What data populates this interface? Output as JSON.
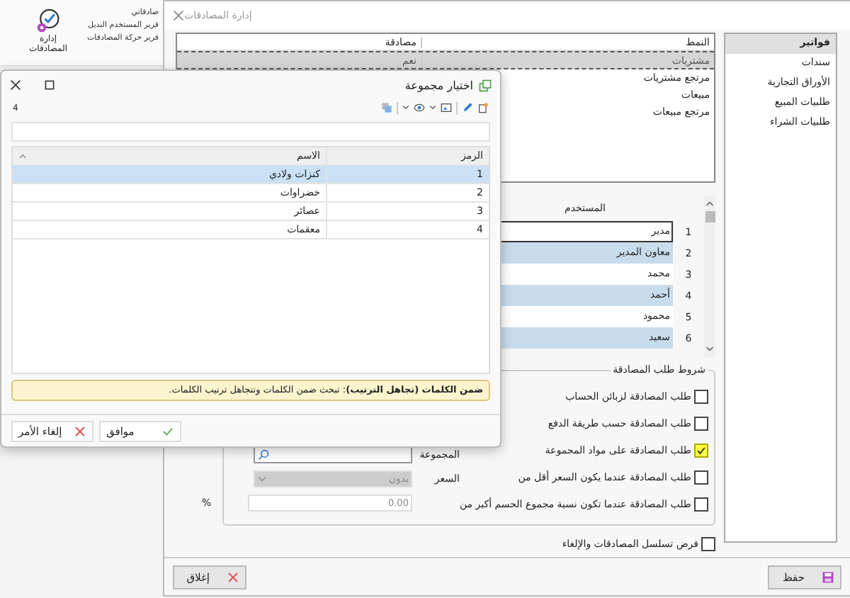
{
  "ribbon": {
    "button": "إدارة المصادقات",
    "menu_items": [
      "صادقاتي",
      "قرير المستخدم البديل",
      "قرير حركة المصادقات"
    ]
  },
  "main_window": {
    "title": "إدارة المصادقات",
    "sidebar": [
      {
        "label": "فواتير",
        "selected": true
      },
      {
        "label": "سندات",
        "selected": false
      },
      {
        "label": "الأوراق التجارية",
        "selected": false
      },
      {
        "label": "طلبيات المبيع",
        "selected": false
      },
      {
        "label": "طلبيات الشراء",
        "selected": false
      }
    ],
    "types_table": {
      "columns": [
        "النمط",
        "مصادقة"
      ],
      "rows": [
        {
          "cells": [
            "مشتريات",
            "نعم"
          ],
          "selected": true
        },
        {
          "cells": [
            "مرتجع مشتريات"
          ],
          "selected": false
        },
        {
          "cells": [
            "مبيعات"
          ],
          "selected": false
        },
        {
          "cells": [
            "مرتجع مبيعات"
          ],
          "selected": false
        }
      ]
    },
    "users_table": {
      "column": "المستخدم",
      "rows": [
        {
          "number": "1",
          "name": "مدير"
        },
        {
          "number": "2",
          "name": "معاون المدير"
        },
        {
          "number": "3",
          "name": "محمد"
        },
        {
          "number": "4",
          "name": "أحمد"
        },
        {
          "number": "5",
          "name": "محمود"
        },
        {
          "number": "6",
          "name": "سعيد"
        }
      ]
    },
    "conditions": {
      "title": "شروط طلب المصادقة",
      "options": [
        {
          "label": "طلب المصادقة لزبائن الحساب",
          "checked": false,
          "highlighted": false
        },
        {
          "label": "طلب المصادقة حسب طريقة الدفع",
          "checked": false,
          "highlighted": false
        },
        {
          "label": "طلب المصادقة على مواد المجموعة",
          "checked": true,
          "highlighted": true
        },
        {
          "label": "طلب المصادقة عندما يكون السعر أقل من",
          "checked": false,
          "highlighted": false
        },
        {
          "label": "طلب المصادقة عندما تكون نسبة مجموع الحسم أكبر من",
          "checked": false,
          "highlighted": false
        }
      ],
      "group_label": "المجموعة",
      "price_label": "السعر",
      "price_value": "بدون",
      "price_disabled": true,
      "percent_value": "0.00",
      "percent_sign": "%"
    },
    "enforce_sequence": {
      "label": "فرض تسلسل المصادقات والإلغاء",
      "checked": false
    },
    "buttons": {
      "save": "حفظ",
      "close": "إغلاق"
    }
  },
  "dialog": {
    "title": "اختيار مجموعة",
    "count": "4",
    "table": {
      "columns": [
        "الرمز",
        "الاسم"
      ],
      "rows": [
        {
          "code": "1",
          "name": "كنزات ولادي",
          "selected": true
        },
        {
          "code": "2",
          "name": "خضراوات",
          "selected": false
        },
        {
          "code": "3",
          "name": "عصائر",
          "selected": false
        },
        {
          "code": "4",
          "name": "معقمات",
          "selected": false
        }
      ]
    },
    "hint": "**ضمن الكلمات (تجاهل الترتيب)**: تبحث ضمن الكلمات وتتجاهل ترتيب الكلمات.",
    "buttons": {
      "ok": "موافق",
      "cancel": "إلغاء الأمر"
    }
  }
}
